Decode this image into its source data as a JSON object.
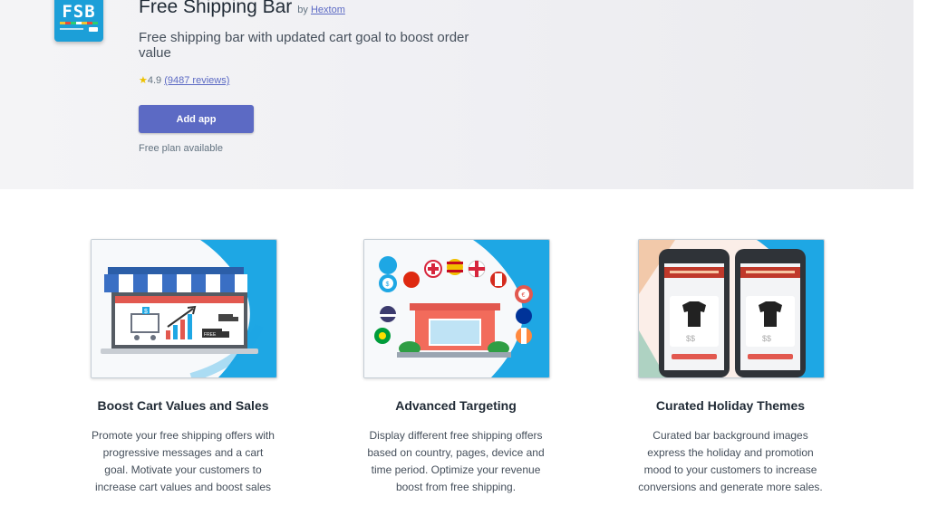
{
  "app": {
    "icon_text": "FSB",
    "title": "Free Shipping Bar",
    "by_prefix": "by",
    "developer": "Hextom",
    "tagline": "Free shipping bar with updated cart goal to boost order value",
    "rating": "4.9",
    "reviews": "(9487 reviews)",
    "add_button": "Add app",
    "plan_note": "Free plan available"
  },
  "colors": {
    "accent": "#5c6ac4",
    "brand_blue": "#1c9fd8",
    "star": "#eec200"
  },
  "features": [
    {
      "title": "Boost Cart Values and Sales",
      "description": "Promote your free shipping offers with progressive messages and a cart goal. Motivate your customers to increase cart values and boost sales",
      "image_labels": [
        "$",
        "FREE"
      ]
    },
    {
      "title": "Advanced Targeting",
      "description": "Display different free shipping offers based on country, pages, device and time period. Optimize your revenue boost from free shipping.",
      "image_labels": [
        "$",
        "€"
      ]
    },
    {
      "title": "Curated Holiday Themes",
      "description": "Curated bar background images express the holiday and promotion mood to your customers to increase conversions and generate more sales.",
      "image_labels": [
        "$$",
        "$$"
      ]
    }
  ]
}
